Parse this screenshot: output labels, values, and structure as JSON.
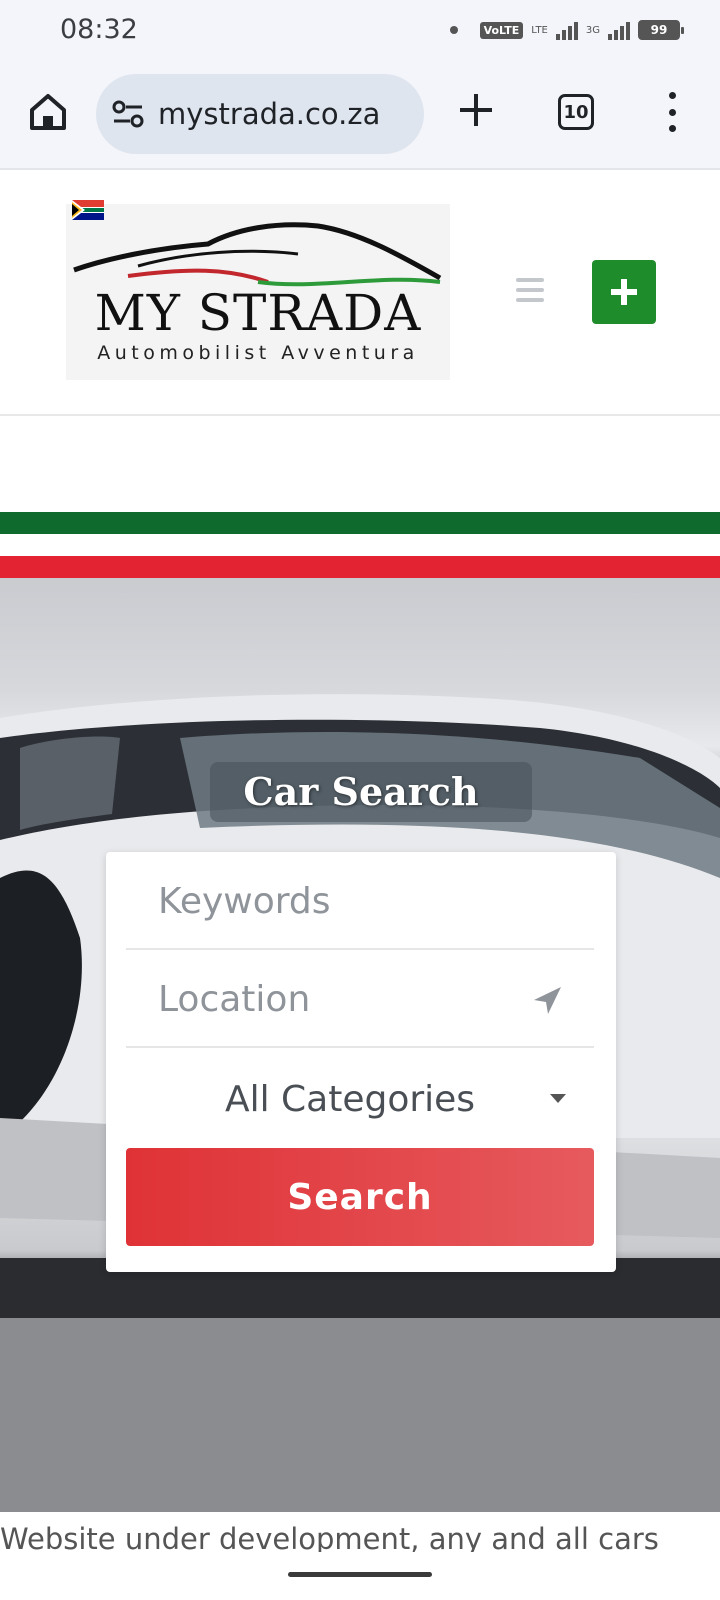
{
  "status_bar": {
    "time": "08:32",
    "volte": "VoLTE",
    "lte": "LTE",
    "net_3g": "3G",
    "battery": "99"
  },
  "browser": {
    "url": "mystrada.co.za",
    "tab_count": "10"
  },
  "site": {
    "logo_title": "MY STRADA",
    "logo_tagline": "Automobilist Avventura",
    "add_label": "+"
  },
  "hero": {
    "title": "Car Search",
    "keywords_placeholder": "Keywords",
    "location_placeholder": "Location",
    "category_value": "All Categories",
    "search_label": "Search"
  },
  "notice": "Website under development, any and all cars",
  "colors": {
    "brand_green": "#1f8c2c",
    "stripe_green": "#0f6a2e",
    "stripe_red": "#e32232",
    "search_button": "#df3236"
  }
}
